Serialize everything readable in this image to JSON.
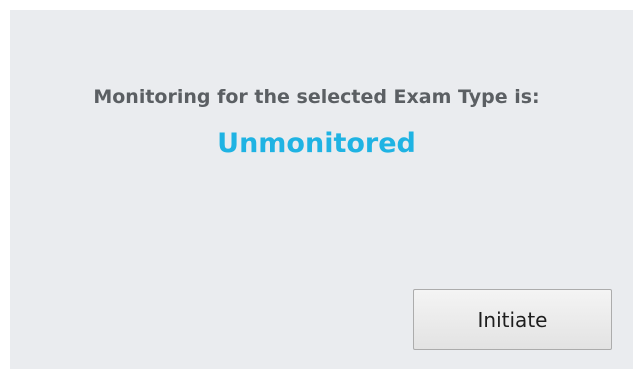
{
  "dialog": {
    "message": "Monitoring for the selected Exam Type is:",
    "status": "Unmonitored",
    "initiate_label": "Initiate"
  },
  "colors": {
    "status_accent": "#1fb3e3",
    "message_text": "#5b5f63",
    "panel_background": "#eaecef"
  }
}
